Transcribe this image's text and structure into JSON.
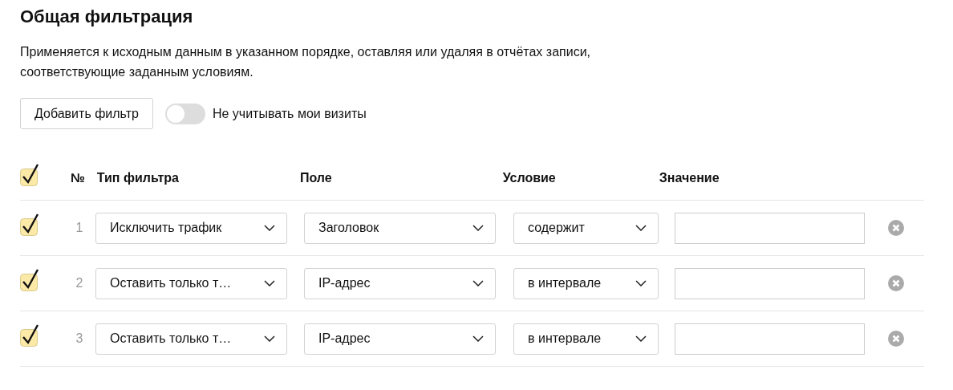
{
  "title": "Общая фильтрация",
  "description": "Применяется к исходным данным в указанном порядке, оставляя или удаляя в отчётах записи, соответствующие заданным условиям.",
  "add_button": "Добавить фильтр",
  "toggle": {
    "label": "Не учитывать мои визиты",
    "on": false
  },
  "table": {
    "select_all": {
      "checked": true
    },
    "columns": [
      "№",
      "Тип фильтра",
      "Поле",
      "Условие",
      "Значение"
    ],
    "rows": [
      {
        "checked": true,
        "number": "1",
        "filter_type": "Исключить трафик",
        "field": "Заголовок",
        "condition": "содержит"
      },
      {
        "checked": true,
        "number": "2",
        "filter_type": "Оставить только т…",
        "field": "IP-адрес",
        "condition": "в интервале"
      },
      {
        "checked": true,
        "number": "3",
        "filter_type": "Оставить только т…",
        "field": "IP-адрес",
        "condition": "в интервале"
      }
    ]
  }
}
